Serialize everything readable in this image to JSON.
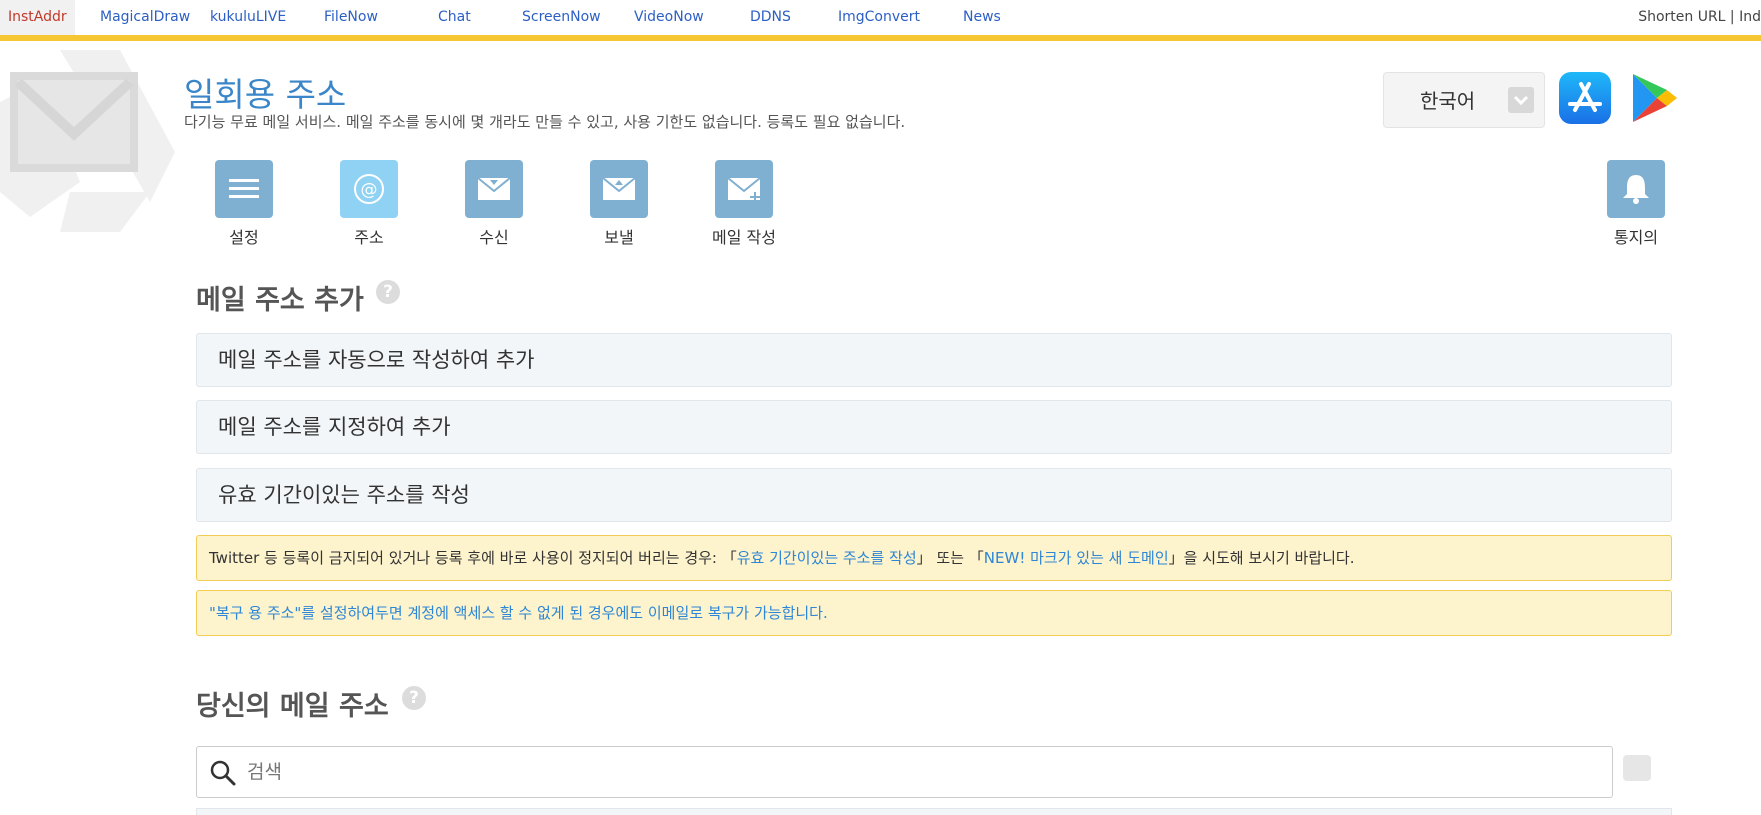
{
  "topnav": {
    "links": [
      "InstAddr",
      "MagicalDraw",
      "kukuluLIVE",
      "FileNow",
      "Chat",
      "ScreenNow",
      "VideoNow",
      "DDNS",
      "ImgConvert",
      "News"
    ],
    "right_link": "Shorten URL | Ind"
  },
  "header": {
    "title": "일회용 주소",
    "subtitle": "다기능 무료 메일 서비스. 메일 주소를 동시에 몇 개라도 만들 수 있고, 사용 기한도 없습니다. 등록도 필요 없습니다.",
    "language": "한국어"
  },
  "nav": {
    "settings": "설정",
    "address": "주소",
    "inbox": "수신",
    "sent": "보낼",
    "compose": "메일 작성",
    "notifications": "통지의"
  },
  "add_section": {
    "title": "메일 주소 추가",
    "help": "?",
    "actions": [
      "메일 주소를 자동으로 작성하여 추가",
      "메일 주소를 지정하여 추가",
      "유효 기간이있는 주소를 작성"
    ]
  },
  "notices": {
    "n1_pre": "Twitter 등 등록이 금지되어 있거나 등록 후에 바로 사용이 정지되어 버리는 경우: 「",
    "n1_link1": "유효 기간이있는 주소를 작성",
    "n1_mid": "」 또는 「",
    "n1_link2": "NEW! 마크가 있는 새 도메인",
    "n1_post": "」을 시도해 보시기 바랍니다.",
    "n2_link": "\"복구 용 주소\"를 설정하여두면 계정에 액세스 할 수 없게 된 경우에도 이메일로 복구가 가능합니다."
  },
  "your_section": {
    "title": "당신의 메일 주소",
    "help": "?",
    "search_placeholder": "검색"
  }
}
